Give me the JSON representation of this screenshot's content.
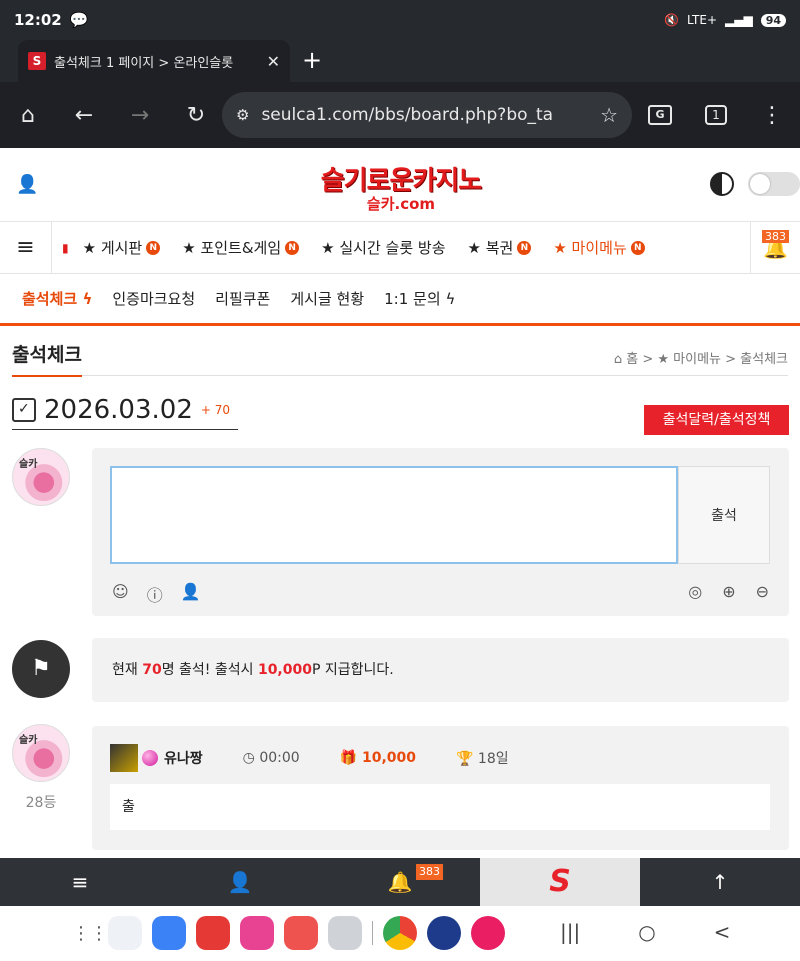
{
  "status_bar": {
    "time": "12:02",
    "network": "LTE+",
    "battery": "94"
  },
  "browser": {
    "tab_title": "출석체크 1 페이지 > 온라인슬롯",
    "url": "seulca1.com/bbs/board.php?bo_ta",
    "tab_count": "1",
    "translate_label": "G",
    "favicon_letter": "S"
  },
  "site": {
    "logo_main": "슬기로운카지노",
    "logo_sub": "슬카.com"
  },
  "main_menu": {
    "items": [
      "★ 게시판",
      "★ 포인트&게임",
      "★ 실시간 슬롯 방송",
      "★ 복권",
      "★ 마이메뉴"
    ],
    "badge": "N",
    "notification_count": "383"
  },
  "sub_menu": {
    "items": [
      "출석체크",
      "인증마크요청",
      "리필쿠폰",
      "게시글 현황",
      "1:1 문의"
    ]
  },
  "page": {
    "title": "출석체크",
    "breadcrumb": "홈 > ★ 마이메뉴 > 출석체크",
    "date": "2026.03.02",
    "date_count": "+ 70",
    "policy_button": "출석달력/출석정책",
    "avatar_tag": "슬카",
    "write": {
      "textarea_value": "",
      "submit_label": "출석"
    },
    "notice": {
      "prefix": "현재 ",
      "count": "70",
      "mid": "명 출석! 출석시 ",
      "points": "10,000",
      "suffix": "P 지급합니다."
    },
    "entry": {
      "rank": "28등",
      "nickname": "유나짱",
      "time": "00:00",
      "points": "10,000",
      "days": "18일",
      "comment": "출"
    }
  },
  "bottom_nav": {
    "notification_count": "383",
    "home_label": "S"
  },
  "colors": {
    "accent": "#e84a0c",
    "brand_red": "#e8222a",
    "dark_bar": "#2f3338"
  }
}
